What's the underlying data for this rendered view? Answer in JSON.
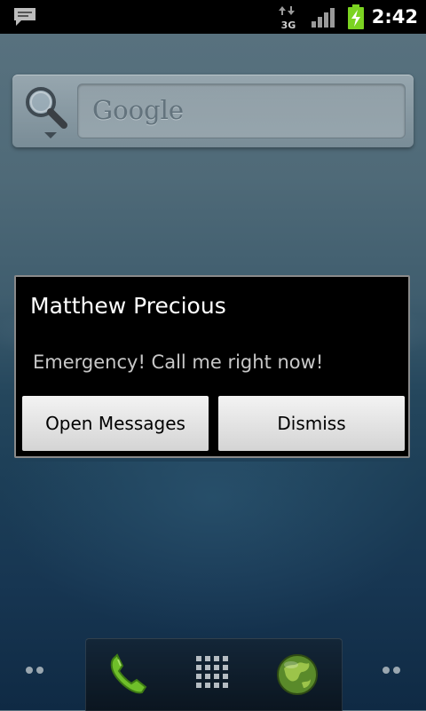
{
  "status_bar": {
    "time": "2:42",
    "network_type": "3G",
    "icons": [
      "message-notification-icon",
      "3g-data-icon",
      "signal-strength-icon",
      "battery-charging-icon"
    ]
  },
  "search_widget": {
    "logo_text": "Google",
    "icons": [
      "search-icon",
      "dropdown-arrow-icon"
    ]
  },
  "dialog": {
    "title": "Matthew Precious",
    "message": "Emergency! Call me right now!",
    "buttons": {
      "open": "Open Messages",
      "dismiss": "Dismiss"
    }
  },
  "dock": {
    "icons": [
      "phone-icon",
      "app-drawer-icon",
      "browser-globe-icon"
    ],
    "page_indicators": [
      "page-indicator-left",
      "page-indicator-right"
    ]
  },
  "colors": {
    "status_bar_bg": "#000000",
    "dialog_bg": "#000000",
    "dialog_border": "#8a8a8a",
    "button_bg": "#e2e2e2",
    "battery_green": "#7bd321",
    "phone_green": "#6fbf2a"
  }
}
